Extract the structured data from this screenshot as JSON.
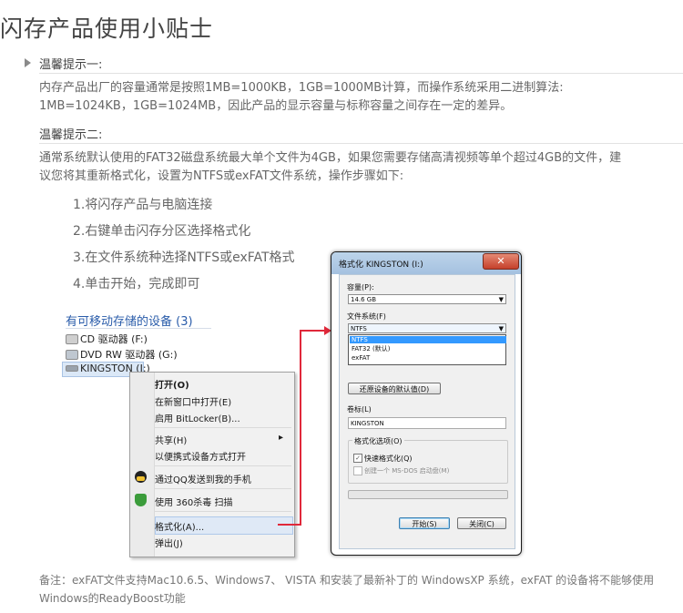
{
  "page": {
    "title": "闪存产品使用小贴士",
    "tip1": {
      "label": "温馨提示一:",
      "line1": "内存产品出厂的容量通常是按照1MB=1000KB，1GB=1000MB计算，而操作系统采用二进制算法:",
      "line2": "1MB=1024KB，1GB=1024MB，因此产品的显示容量与标称容量之间存在一定的差异。"
    },
    "tip2": {
      "label": "温馨提示二:",
      "line1": "通常系统默认使用的FAT32磁盘系统最大单个文件为4GB，如果您需要存储高清视频等单个超过4GB的文件，建",
      "line2": "议您将其重新格式化，设置为NTFS或exFAT文件系统，操作步骤如下:"
    },
    "steps": [
      "1.将闪存产品与电脑连接",
      "2.右键单击闪存分区选择格式化",
      "3.在文件系统种选择NTFS或exFAT格式",
      "4.单击开始，完成即可"
    ],
    "note": {
      "line1": "备注：exFAT文件支持Mac10.6.5、Windows7、 VISTA  和安装了最新补丁的 WindowsXP 系统，exFAT 的设备将不能够使用",
      "line2": "Windows的ReadyBoost功能"
    }
  },
  "explorer": {
    "section_title": "有可移动存储的设备 (3)",
    "devices": [
      {
        "label": "CD 驱动器 (F:)",
        "icon": "cd-drive-icon"
      },
      {
        "label": "DVD RW 驱动器 (G:)",
        "icon": "dvd-drive-icon"
      },
      {
        "label": "KINGSTON (I:)",
        "icon": "usb-drive-icon",
        "selected": true
      }
    ]
  },
  "context_menu": {
    "open": "打开(O)",
    "open_new_window": "在新窗口中打开(E)",
    "bitlocker": "启用 BitLocker(B)...",
    "share": "共享(H)",
    "share_arrow": "▸",
    "portable": "以便携式设备方式打开",
    "qq_send": "通过QQ发送到我的手机",
    "scan_360": "使用 360杀毒 扫描",
    "format": "格式化(A)...",
    "eject": "弹出(J)"
  },
  "format_dialog": {
    "title": "格式化 KINGSTON (I:)",
    "close": "✕",
    "capacity_label": "容量(P):",
    "capacity_value": "14.6 GB",
    "filesystem_label": "文件系统(F)",
    "filesystem_value": "NTFS",
    "filesystem_options": [
      "NTFS",
      "FAT32 (默认)",
      "exFAT"
    ],
    "restore_defaults": "还原设备的默认值(D)",
    "volume_label_label": "卷标(L)",
    "volume_label_value": "KINGSTON",
    "format_options_label": "格式化选项(O)",
    "quick_format": "快速格式化(Q)",
    "quick_format_checked": true,
    "msdos_boot": "创建一个 MS-DOS 启动盘(M)",
    "msdos_boot_checked": false,
    "start": "开始(S)",
    "close_button": "关闭(C)"
  },
  "colors": {
    "highlight_arrow": "#e0283a",
    "link_blue": "#2a5caa"
  }
}
